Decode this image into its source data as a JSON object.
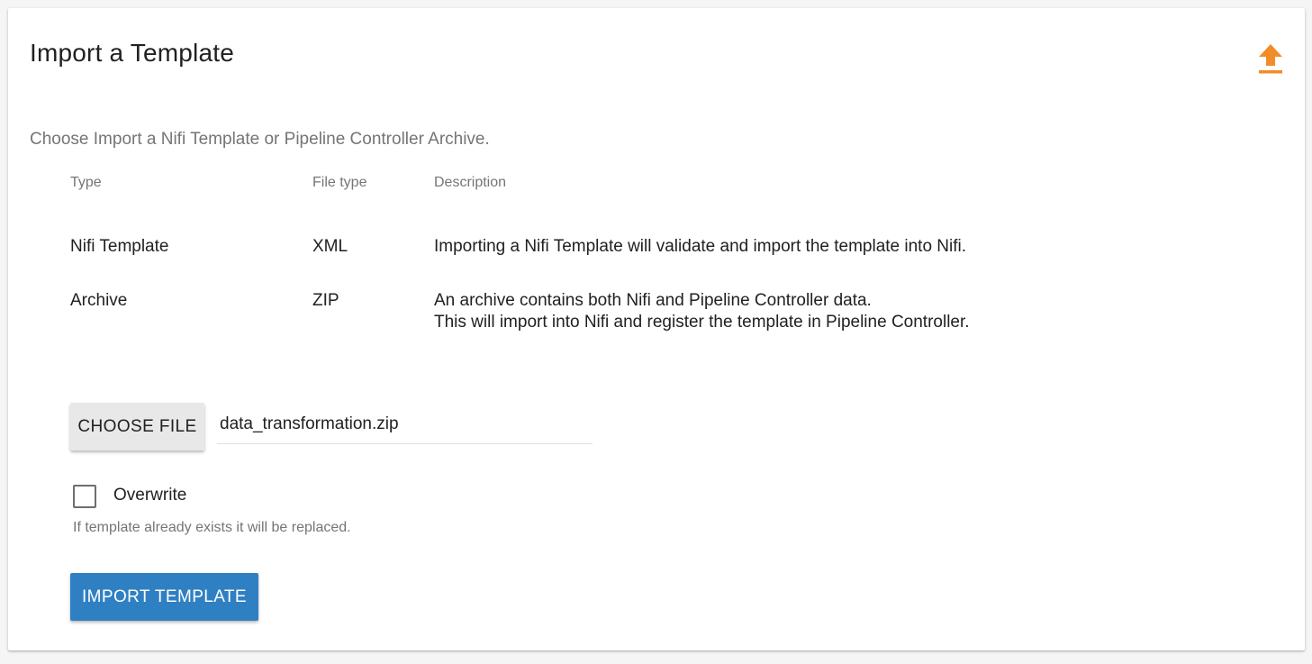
{
  "page": {
    "title": "Import a Template",
    "intro": "Choose Import a Nifi Template or Pipeline Controller Archive.",
    "upload_icon": "upload-icon",
    "accent_color": "#f28c28"
  },
  "table": {
    "headers": [
      "Type",
      "File type",
      "Description"
    ],
    "rows": [
      {
        "type": "Nifi Template",
        "file_type": "XML",
        "description_lines": [
          "Importing a Nifi Template will validate and import the template into Nifi."
        ]
      },
      {
        "type": "Archive",
        "file_type": "ZIP",
        "description_lines": [
          "An archive contains both Nifi and Pipeline Controller data.",
          "This will import into Nifi and register the template in Pipeline Controller."
        ]
      }
    ]
  },
  "file": {
    "button_label": "CHOOSE FILE",
    "selected_name": "data_transformation.zip"
  },
  "overwrite": {
    "label": "Overwrite",
    "checked": false,
    "hint": "If template already exists it will be replaced."
  },
  "actions": {
    "import_label": "IMPORT TEMPLATE",
    "import_color": "#2f80c2"
  }
}
